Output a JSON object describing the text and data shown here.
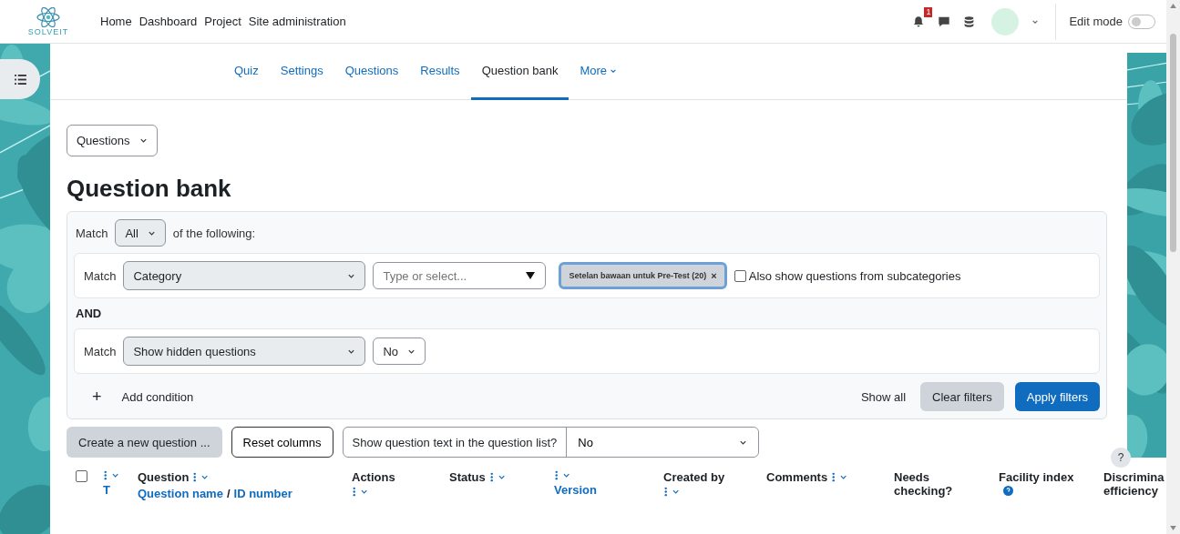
{
  "header": {
    "brand": "SOLVEIT",
    "nav": [
      "Home",
      "Dashboard",
      "Project",
      "Site administration"
    ],
    "notification_count": "1",
    "edit_mode": {
      "label": "Edit mode",
      "on": false
    }
  },
  "tabs": [
    {
      "label": "Quiz",
      "selected": false,
      "caret": false
    },
    {
      "label": "Settings",
      "selected": false,
      "caret": false
    },
    {
      "label": "Questions",
      "selected": false,
      "caret": false
    },
    {
      "label": "Results",
      "selected": false,
      "caret": false
    },
    {
      "label": "Question bank",
      "selected": true,
      "caret": false
    },
    {
      "label": "More",
      "selected": false,
      "caret": true
    }
  ],
  "page_select": "Questions",
  "title": "Question bank",
  "filters": {
    "match_label": "Match",
    "match_value": "All",
    "match_suffix": "of the following:",
    "conditions": [
      {
        "label": "Match",
        "field": "Category",
        "search_placeholder": "Type or select...",
        "chips": [
          {
            "label": "Setelan bawaan untuk Pre-Test (20)",
            "remove": "×"
          }
        ],
        "option": {
          "label": "Also show questions from subcategories",
          "checked": false
        }
      },
      {
        "label": "Match",
        "field": "Show hidden questions",
        "value": "No"
      }
    ],
    "joiner": "AND",
    "add_icon": "+",
    "add_label": "Add condition",
    "show_all": "Show all",
    "clear": "Clear filters",
    "apply": "Apply filters"
  },
  "actions": {
    "create": "Create a new question ...",
    "reset": "Reset columns",
    "show_text_label": "Show question text in the question list?",
    "show_text_value": "No"
  },
  "table": {
    "columns": [
      {
        "kind": "checkbox",
        "checked": false
      },
      {
        "kind": "header",
        "title_menu": true,
        "sub": [
          {
            "text": "T",
            "kind": "link"
          }
        ],
        "sub_menu": false
      },
      {
        "kind": "header",
        "title": "Question",
        "title_menu": true,
        "sub": [
          {
            "text": "Question name",
            "kind": "link"
          },
          {
            "text": "/",
            "kind": "plain"
          },
          {
            "text": "ID number",
            "kind": "link"
          }
        ],
        "sub_menu": false,
        "info": false
      },
      {
        "kind": "header",
        "title": "Actions",
        "title_menu": false,
        "sub_menu": true,
        "info": false
      },
      {
        "kind": "header",
        "title": "Status",
        "title_menu": true,
        "sub_menu": false,
        "info": false
      },
      {
        "kind": "header",
        "title_menu": true,
        "sub": [
          {
            "text": "Version",
            "kind": "link"
          }
        ],
        "sub_menu": false
      },
      {
        "kind": "header",
        "title": "Created by",
        "title_menu": false,
        "sub_menu": true,
        "info": false
      },
      {
        "kind": "header",
        "title": "Comments",
        "title_menu": true,
        "sub_menu": false,
        "info": false
      },
      {
        "kind": "header",
        "title": "Needs checking?",
        "title_menu": false,
        "sub_menu": false,
        "info": false
      },
      {
        "kind": "header",
        "title": "Facility index",
        "title_menu": false,
        "sub_menu": false,
        "info": true
      },
      {
        "kind": "header",
        "title": "Discrimina efficiency",
        "info": false
      }
    ]
  },
  "help_button": "?"
}
